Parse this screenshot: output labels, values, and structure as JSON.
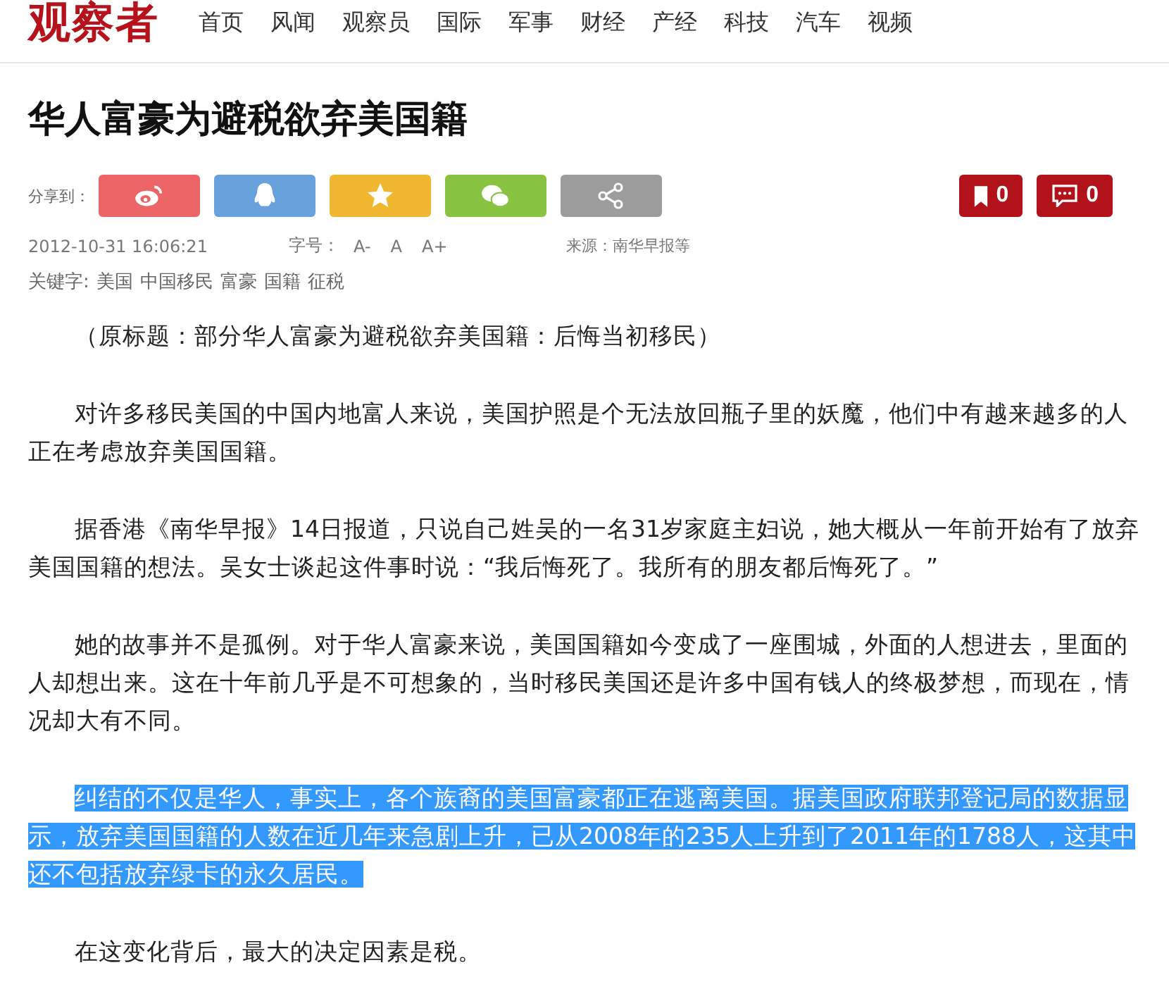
{
  "header": {
    "logo": "观察者",
    "nav": [
      "首页",
      "风闻",
      "观察员",
      "国际",
      "军事",
      "财经",
      "产经",
      "科技",
      "汽车",
      "视频"
    ]
  },
  "article": {
    "title": "华人富豪为避税欲弃美国籍",
    "share": {
      "label": "分享到：",
      "buttons": [
        {
          "kind": "weibo",
          "color": "#ec6466"
        },
        {
          "kind": "qq",
          "color": "#68a1dc"
        },
        {
          "kind": "qzone",
          "color": "#f2b731"
        },
        {
          "kind": "wechat",
          "color": "#88c441"
        },
        {
          "kind": "more",
          "color": "#9c9c9c"
        }
      ]
    },
    "counters": [
      {
        "kind": "bookmark",
        "count": "0"
      },
      {
        "kind": "comment",
        "count": "0"
      }
    ],
    "date": "2012-10-31 16:06:21",
    "font_size": {
      "label": "字号：",
      "options": [
        "A-",
        "A",
        "A+"
      ]
    },
    "source": "来源：南华早报等",
    "keywords": {
      "label": "关键字:",
      "items": [
        "美国",
        "中国移民",
        "富豪",
        "国籍",
        "征税"
      ]
    },
    "paragraphs": [
      {
        "text": "（原标题：部分华人富豪为避税欲弃美国籍：后悔当初移民）",
        "selected": false
      },
      {
        "text": "对许多移民美国的中国内地富人来说，美国护照是个无法放回瓶子里的妖魔，他们中有越来越多的人正在考虑放弃美国国籍。",
        "selected": false
      },
      {
        "text": "据香港《南华早报》14日报道，只说自己姓吴的一名31岁家庭主妇说，她大概从一年前开始有了放弃美国国籍的想法。吴女士谈起这件事时说：“我后悔死了。我所有的朋友都后悔死了。”",
        "selected": false
      },
      {
        "text": "她的故事并不是孤例。对于华人富豪来说，美国国籍如今变成了一座围城，外面的人想进去，里面的人却想出来。这在十年前几乎是不可想象的，当时移民美国还是许多中国有钱人的终极梦想，而现在，情况却大有不同。",
        "selected": false
      },
      {
        "text": "纠结的不仅是华人，事实上，各个族裔的美国富豪都正在逃离美国。据美国政府联邦登记局的数据显示，放弃美国国籍的人数在近几年来急剧上升，已从2008年的235人上升到了2011年的1788人，这其中还不包括放弃绿卡的永久居民。",
        "selected": true
      },
      {
        "text": "在这变化背后，最大的决定因素是税。",
        "selected": false
      }
    ]
  }
}
